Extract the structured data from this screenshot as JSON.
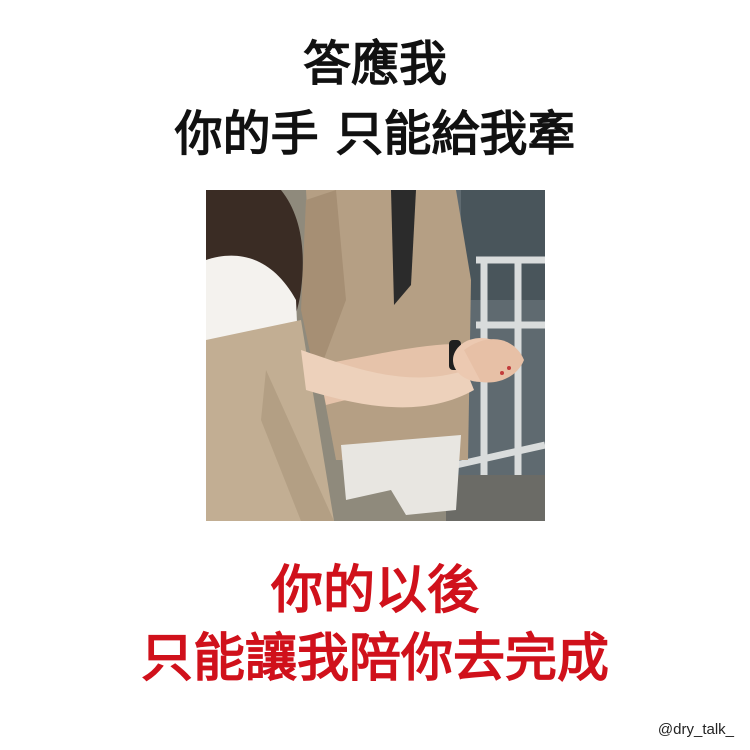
{
  "top_text": {
    "line1": "答應我",
    "line2": "你的手  只能給我牽"
  },
  "bottom_text": {
    "line1": "你的以後",
    "line2": "只能讓我陪你去完成"
  },
  "watermark": "@dry_talk_",
  "colors": {
    "headline": "#111111",
    "caption_accent": "#d0111b",
    "background": "#ffffff"
  },
  "photo": {
    "subject": "couple-holding-hands-photo"
  }
}
